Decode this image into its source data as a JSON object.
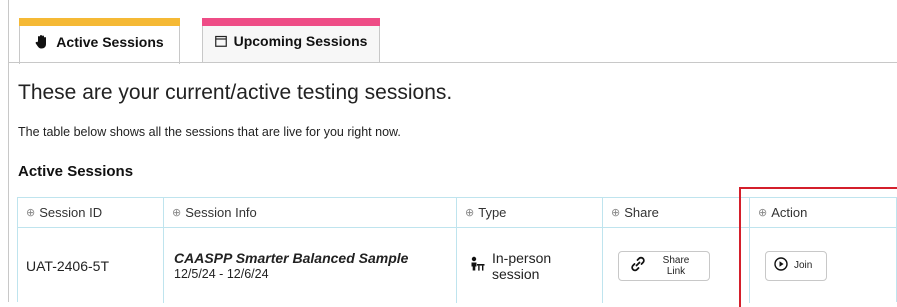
{
  "tabs": [
    {
      "label": "Active Sessions",
      "icon": "hand-icon",
      "color": "#f5b935",
      "active": true
    },
    {
      "label": "Upcoming Sessions",
      "icon": "calendar-icon",
      "color": "#ee4c86",
      "active": false
    }
  ],
  "main": {
    "heading": "These are your current/active testing sessions.",
    "subtext": "The table below shows all the sessions that are live for you right now.",
    "section_title": "Active Sessions"
  },
  "table": {
    "headers": [
      "Session ID",
      "Session Info",
      "Type",
      "Share",
      "Action"
    ],
    "rows": [
      {
        "session_id": "UAT-2406-5T",
        "title": "CAASPP Smarter Balanced Sample",
        "dates": "12/5/24 - 12/6/24",
        "type": "In-person session",
        "share_label": "Share Link",
        "action_label": "Join"
      }
    ]
  },
  "colors": {
    "active_tab_accent": "#f5b935",
    "upcoming_tab_accent": "#ee4c86",
    "table_border": "#bfe4ee",
    "highlight_box": "#d41f2b"
  }
}
